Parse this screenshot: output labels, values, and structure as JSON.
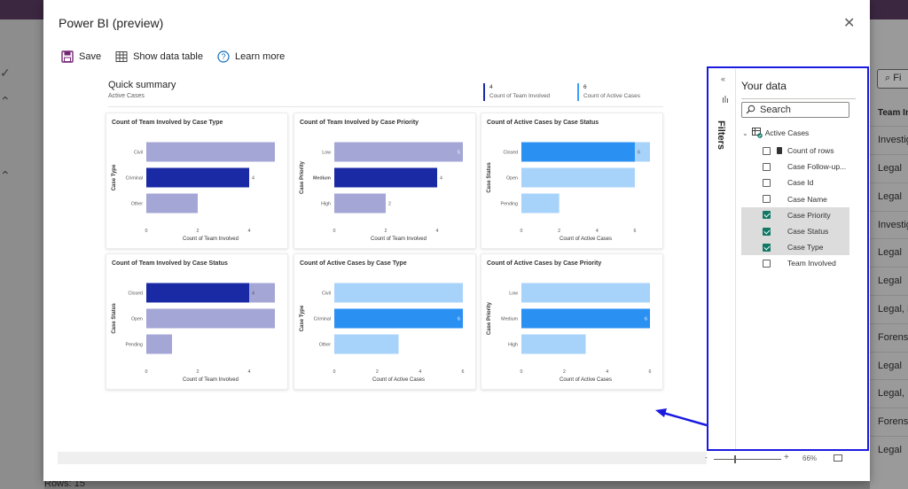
{
  "dialog": {
    "title": "Power BI (preview)",
    "close_glyph": "✕"
  },
  "toolbar": {
    "save": "Save",
    "show_data_table": "Show data table",
    "learn_more": "Learn more"
  },
  "report": {
    "title": "Quick summary",
    "subtitle": "Active Cases",
    "kpis": [
      {
        "value": "4",
        "label": "Count of Team Involved"
      },
      {
        "value": "6",
        "label": "Count of Active Cases"
      }
    ]
  },
  "chart_data": [
    {
      "type": "bar",
      "title": "Count of Team Involved by Case Type",
      "categories": [
        "Civil",
        "Criminal",
        "Other"
      ],
      "values": [
        5,
        4,
        2
      ],
      "highlight": [
        null,
        4,
        null
      ],
      "highlight_index": 1,
      "xlabel": "Count of Team Involved",
      "ylabel": "Case Type",
      "xticks": [
        "0",
        "2",
        "4"
      ],
      "xlim": [
        0,
        5
      ],
      "base_color": "#a4a6d6",
      "highlight_color": "#1a2aa5",
      "data_labels": [
        "",
        "4",
        ""
      ],
      "bold_category": false
    },
    {
      "type": "bar",
      "title": "Count of Team Involved by Case Priority",
      "categories": [
        "Low",
        "Medium",
        "High"
      ],
      "values": [
        5,
        4,
        2
      ],
      "highlight": [
        null,
        4,
        null
      ],
      "highlight_index": 1,
      "xlabel": "Count of Team Involved",
      "ylabel": "Case Priority",
      "xticks": [
        "0",
        "2",
        "4"
      ],
      "xlim": [
        0,
        5
      ],
      "base_color": "#a4a6d6",
      "highlight_color": "#1a2aa5",
      "data_labels": [
        "5",
        "4",
        "2"
      ],
      "bold_category": true
    },
    {
      "type": "bar",
      "title": "Count of Active Cases by Case Status",
      "categories": [
        "Closed",
        "Open",
        "Pending"
      ],
      "values": [
        6.8,
        6,
        2
      ],
      "highlight": [
        6,
        null,
        null
      ],
      "highlight_index": 0,
      "xlabel": "Count of Active Cases",
      "ylabel": "Case Status",
      "xticks": [
        "0",
        "2",
        "4",
        "6"
      ],
      "xlim": [
        0,
        6.8
      ],
      "base_color": "#a7d3fb",
      "highlight_color": "#2a90f2",
      "data_labels": [
        "6",
        "",
        ""
      ],
      "bold_category": false
    },
    {
      "type": "bar",
      "title": "Count of Team Involved by Case Status",
      "categories": [
        "Closed",
        "Open",
        "Pending"
      ],
      "values": [
        5,
        5,
        1
      ],
      "highlight": [
        4,
        null,
        null
      ],
      "highlight_index": 0,
      "xlabel": "Count of Team Involved",
      "ylabel": "Case Status",
      "xticks": [
        "0",
        "2",
        "4"
      ],
      "xlim": [
        0,
        5
      ],
      "base_color": "#a4a6d6",
      "highlight_color": "#1a2aa5",
      "data_labels": [
        "4",
        "",
        ""
      ],
      "bold_category": false
    },
    {
      "type": "bar",
      "title": "Count of Active Cases by Case Type",
      "categories": [
        "Civil",
        "Criminal",
        "Other"
      ],
      "values": [
        6,
        6,
        3
      ],
      "highlight": [
        null,
        6,
        null
      ],
      "highlight_index": 1,
      "xlabel": "Count of Active Cases",
      "ylabel": "Case Type",
      "xticks": [
        "0",
        "2",
        "4",
        "6"
      ],
      "xlim": [
        0,
        6
      ],
      "base_color": "#a7d3fb",
      "highlight_color": "#2a90f2",
      "data_labels": [
        "",
        "6",
        ""
      ],
      "bold_category": false
    },
    {
      "type": "bar",
      "title": "Count of Active Cases by Case Priority",
      "categories": [
        "Low",
        "Medium",
        "High"
      ],
      "values": [
        6,
        6,
        3
      ],
      "highlight": [
        null,
        6,
        null
      ],
      "highlight_index": 1,
      "xlabel": "Count of Active Cases",
      "ylabel": "Case Priority",
      "xticks": [
        "0",
        "2",
        "4",
        "6"
      ],
      "xlim": [
        0,
        6
      ],
      "base_color": "#a7d3fb",
      "highlight_color": "#2a90f2",
      "data_labels": [
        "",
        "6",
        ""
      ],
      "bold_category": false
    }
  ],
  "zoom": {
    "minus": "-",
    "plus": "+",
    "percent": "66%",
    "level": 0.3
  },
  "filters_pane": {
    "collapse_glyph": "«",
    "label": "Filters"
  },
  "your_data": {
    "title": "Your data",
    "search_placeholder": "Search",
    "table_name": "Active Cases",
    "fields": [
      {
        "label": "Count of rows",
        "checked": false,
        "calc": true
      },
      {
        "label": "Case Follow-up...",
        "checked": false
      },
      {
        "label": "Case Id",
        "checked": false
      },
      {
        "label": "Case Name",
        "checked": false
      },
      {
        "label": "Case Priority",
        "checked": true
      },
      {
        "label": "Case Status",
        "checked": true
      },
      {
        "label": "Case Type",
        "checked": true
      },
      {
        "label": "Team Involved",
        "checked": false
      }
    ]
  },
  "background": {
    "search_prefix": "Fi",
    "column_header": "Team Inv",
    "cells": [
      "Investig",
      "Legal",
      "Legal",
      "Investig",
      "Legal",
      "Legal",
      "Legal, F",
      "Forensi",
      "Legal",
      "Legal, I",
      "Forensi",
      "Legal"
    ],
    "rows_label": "Rows: 15"
  },
  "colors": {
    "highlight_border": "#1a1ae0",
    "check": "#117865",
    "save_icon": "#742774"
  }
}
